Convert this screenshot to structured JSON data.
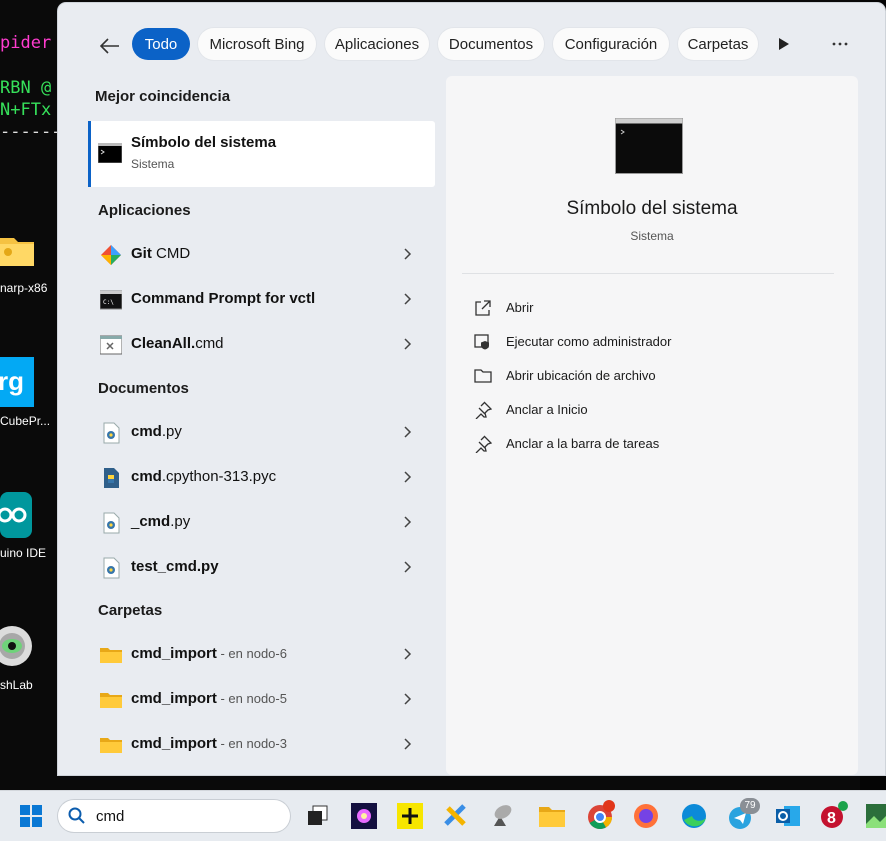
{
  "background": {
    "terminal_lines": [
      "pider",
      "RBN @",
      "N+FTx",
      "------"
    ],
    "desktop_labels": [
      "narp-x86",
      "CubePr...",
      "uino IDE",
      "shLab"
    ],
    "tile_text": "rg"
  },
  "filters": {
    "items": [
      {
        "label": "Todo",
        "active": true
      },
      {
        "label": "Microsoft Bing"
      },
      {
        "label": "Aplicaciones"
      },
      {
        "label": "Documentos"
      },
      {
        "label": "Configuración"
      },
      {
        "label": "Carpetas"
      }
    ]
  },
  "best_match": {
    "heading": "Mejor coincidencia",
    "title": "Símbolo del sistema",
    "subtitle": "Sistema"
  },
  "apps": {
    "heading": "Aplicaciones",
    "items": [
      {
        "bold": "Git",
        "rest": " CMD"
      },
      {
        "bold": "Command Prompt for vctl",
        "rest": ""
      },
      {
        "bold": "CleanAll.",
        "rest": "cmd"
      }
    ]
  },
  "documents": {
    "heading": "Documentos",
    "items": [
      {
        "pre": "",
        "bold": "cmd",
        "post": ".py"
      },
      {
        "pre": "",
        "bold": "cmd",
        "post": ".cpython-313.pyc"
      },
      {
        "pre": "_",
        "bold": "cmd",
        "post": ".py"
      },
      {
        "pre": "",
        "bold": "test_cmd.py",
        "post": ""
      }
    ]
  },
  "folders": {
    "heading": "Carpetas",
    "items": [
      {
        "name": "cmd_import",
        "location": " - en nodo-6"
      },
      {
        "name": "cmd_import",
        "location": " - en nodo-5"
      },
      {
        "name": "cmd_import",
        "location": " - en nodo-3"
      }
    ]
  },
  "preview": {
    "title": "Símbolo del sistema",
    "subtitle": "Sistema",
    "actions": [
      {
        "label": "Abrir",
        "icon": "open-external-icon"
      },
      {
        "label": "Ejecutar como administrador",
        "icon": "admin-shield-icon"
      },
      {
        "label": "Abrir ubicación de archivo",
        "icon": "folder-open-icon"
      },
      {
        "label": "Anclar a Inicio",
        "icon": "pin-icon"
      },
      {
        "label": "Anclar a la barra de tareas",
        "icon": "pin-icon"
      }
    ]
  },
  "taskbar": {
    "search_value": "cmd",
    "telegram_badge": "79",
    "colors": {
      "accent": "#0b62c7",
      "panel": "#e9ecf1",
      "taskbar": "#e7ebf0"
    }
  }
}
